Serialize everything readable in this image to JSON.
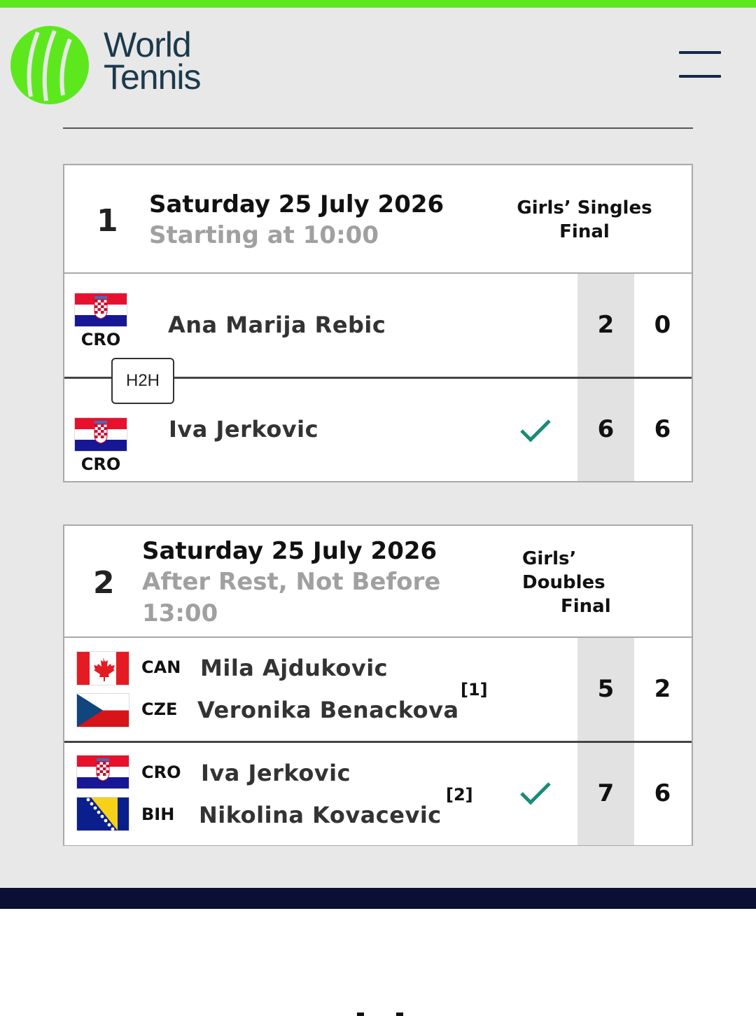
{
  "brand": {
    "line1": "World",
    "line2": "Tennis",
    "green": "#5de81e",
    "navy": "#13294b"
  },
  "menu": {
    "icon": "hamburger-menu-icon"
  },
  "matches": [
    {
      "order": "1",
      "date": "Saturday 25 July 2026",
      "time": "Starting at 10:00",
      "event_line1": "Girls’ Singles",
      "event_line2": "Final",
      "h2h_label": "H2H",
      "teams": [
        {
          "players": [
            {
              "code": "CRO",
              "flag": "croatia-flag",
              "name": "Ana Marija Rebic"
            }
          ],
          "winner": false,
          "scores": [
            "2",
            "0"
          ]
        },
        {
          "players": [
            {
              "code": "CRO",
              "flag": "croatia-flag",
              "name": "Iva Jerkovic"
            }
          ],
          "winner": true,
          "scores": [
            "6",
            "6"
          ]
        }
      ]
    },
    {
      "order": "2",
      "date": "Saturday 25 July 2026",
      "time_line1": "After Rest, Not Before",
      "time_line2": "13:00",
      "event_line1": "Girls’",
      "event_line2": "Doubles",
      "event_line3": "Final",
      "teams": [
        {
          "players": [
            {
              "code": "CAN",
              "flag": "canada-flag",
              "name": "Mila Ajdukovic"
            },
            {
              "code": "CZE",
              "flag": "czech-flag",
              "name": "Veronika Benackova"
            }
          ],
          "seed": "[1]",
          "winner": false,
          "scores": [
            "5",
            "2"
          ]
        },
        {
          "players": [
            {
              "code": "CRO",
              "flag": "croatia-flag",
              "name": "Iva Jerkovic"
            },
            {
              "code": "BIH",
              "flag": "bosnia-flag",
              "name": "Nikolina Kovacevic"
            }
          ],
          "seed": "[2]",
          "winner": true,
          "scores": [
            "7",
            "6"
          ]
        }
      ]
    }
  ],
  "colors": {
    "winner_check": "#1a8a7a",
    "footer": "#0b0f33"
  }
}
